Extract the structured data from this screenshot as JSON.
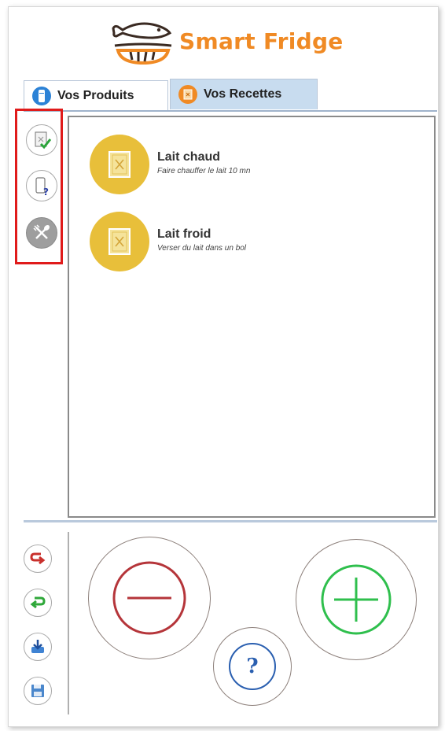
{
  "app": {
    "name": "Smart Fridge",
    "brand_color": "#f08a24"
  },
  "tabs": [
    {
      "label": "Vos Produits",
      "icon": "fridge-icon",
      "selected": false
    },
    {
      "label": "Vos Recettes",
      "icon": "recipe-book-icon",
      "selected": true
    }
  ],
  "side_toolbar": [
    {
      "icon": "validate-recipe-icon"
    },
    {
      "icon": "missing-products-icon"
    },
    {
      "icon": "cutlery-icon"
    }
  ],
  "recipes": [
    {
      "name": "Lait chaud",
      "description": "Faire chauffer le lait 10 mn",
      "icon": "recipe-book-icon"
    },
    {
      "name": "Lait froid",
      "description": "Verser du lait dans un bol",
      "icon": "recipe-book-icon"
    }
  ],
  "bottom_toolbar": [
    {
      "icon": "undo-icon"
    },
    {
      "icon": "redo-icon"
    },
    {
      "icon": "download-icon"
    },
    {
      "icon": "save-icon"
    }
  ],
  "actions": {
    "remove_icon": "minus-icon",
    "add_icon": "plus-icon",
    "help_label": "?",
    "remove_color": "#b5353a",
    "add_color": "#2fbf4d",
    "help_color": "#2a5fb0"
  }
}
